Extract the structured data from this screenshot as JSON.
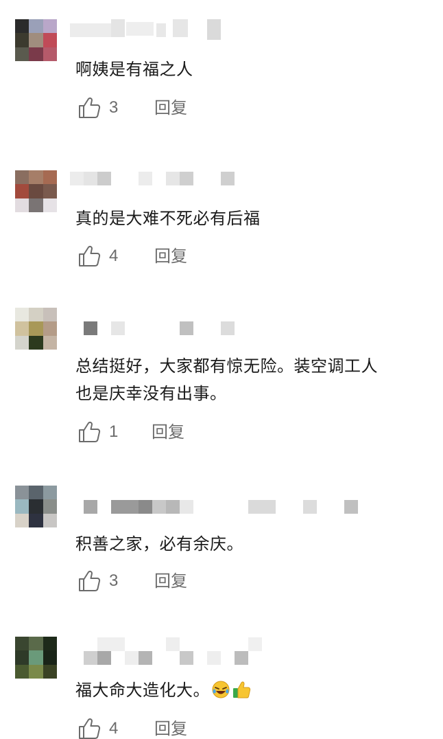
{
  "comments": [
    {
      "avatar_colors": [
        "#2b2b2b",
        "#9aa0b8",
        "#b9a7c9",
        "#3c3a2e",
        "#a08d7e",
        "#c04b58",
        "#5a5a4e",
        "#7a3a4a",
        "#b55a6a"
      ],
      "username_color": "#d5d5d5",
      "text": "啊姨是有福之人",
      "like_count": "3",
      "reply_label": "回复"
    },
    {
      "avatar_colors": [
        "#8a6e60",
        "#a67e68",
        "#a66a52",
        "#a24a3c",
        "#6a4a40",
        "#7a5a4e",
        "#e2dce0",
        "#7a7474",
        "#e6e2e6"
      ],
      "username_color": "#d2d2d2",
      "text": "真的是大难不死必有后福",
      "like_count": "4",
      "reply_label": "回复"
    },
    {
      "avatar_colors": [
        "#e8e8e0",
        "#d4d0c4",
        "#c8c0ba",
        "#d0c29e",
        "#a89858",
        "#b49c88",
        "#d4d4cc",
        "#2c3a1e",
        "#c4b4a4"
      ],
      "username_color": "#c8c8c8",
      "text": "总结挺好，大家都有惊无险。装空调工人",
      "text2": "也是庆幸没有出事。",
      "like_count": "1",
      "reply_label": "回复"
    },
    {
      "avatar_colors": [
        "#8a9298",
        "#5a646c",
        "#8c9aa0",
        "#9ab8c0",
        "#2a2e32",
        "#8a8e8a",
        "#d8d2c8",
        "#2e3240",
        "#c8c6c4"
      ],
      "username_color": "#c4c4c4",
      "text": "积善之家，必有余庆。",
      "like_count": "3",
      "reply_label": "回复"
    },
    {
      "avatar_colors": [
        "#3a4630",
        "#5a6a4a",
        "#1e2a1a",
        "#2e3a28",
        "#6a9a7a",
        "#1a2418",
        "#4a5a30",
        "#7a8a4a",
        "#3a4224"
      ],
      "username_color": "#cacaca",
      "text": "福大命大造化大。",
      "like_count": "4",
      "reply_label": "回复"
    }
  ],
  "icons": {
    "like": "thumbs-up-outline-icon",
    "emoji_1": "laughing-tears-emoji",
    "emoji_2": "thumbs-up-emoji"
  },
  "colors": {
    "text_primary": "#1a1a1a",
    "text_secondary": "#6b6b6b",
    "background": "#ffffff"
  }
}
